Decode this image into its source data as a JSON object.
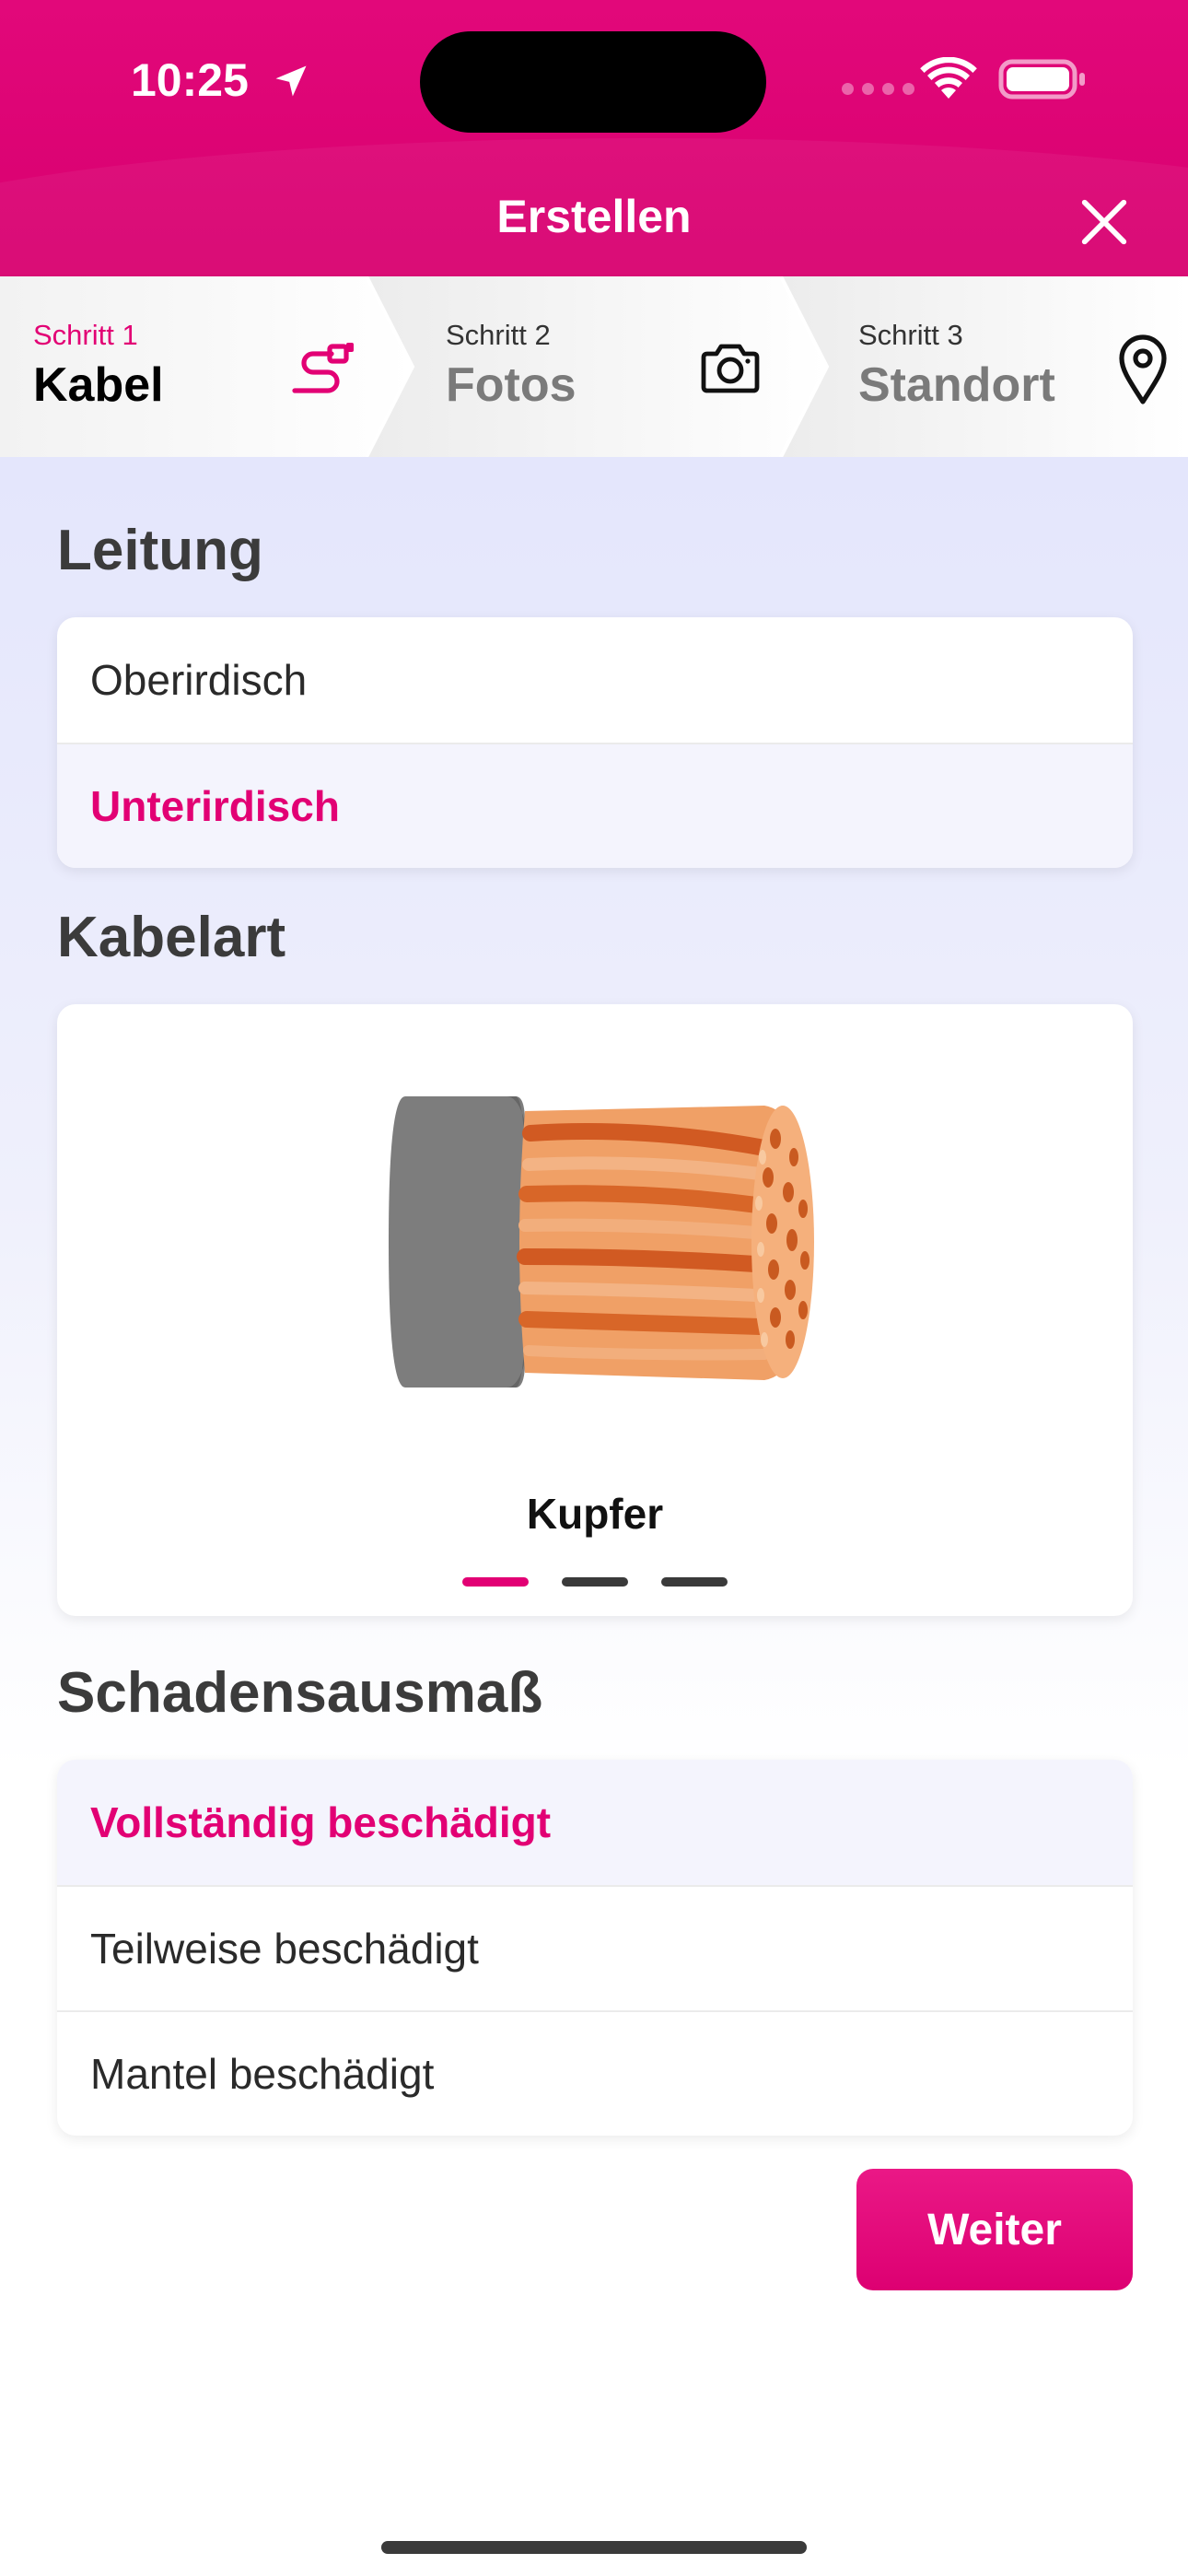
{
  "status_bar": {
    "time": "10:25",
    "icons": [
      "location-arrow-icon",
      "cellular-signal-icon",
      "wifi-icon",
      "battery-icon"
    ]
  },
  "header": {
    "title": "Erstellen",
    "close_icon": "close-icon",
    "color": "#e20074"
  },
  "stepper": {
    "steps": [
      {
        "label": "Schritt 1",
        "title": "Kabel",
        "icon": "cable-plug-icon",
        "active": true
      },
      {
        "label": "Schritt 2",
        "title": "Fotos",
        "icon": "camera-icon",
        "active": false
      },
      {
        "label": "Schritt 3",
        "title": "Standort",
        "icon": "location-pin-icon",
        "active": false
      }
    ]
  },
  "leitung": {
    "title": "Leitung",
    "options": [
      {
        "label": "Oberirdisch",
        "selected": false
      },
      {
        "label": "Unterirdisch",
        "selected": true
      }
    ]
  },
  "kabelart": {
    "title": "Kabelart",
    "selected_label": "Kupfer",
    "image": "copper-cable-illustration",
    "pager": {
      "count": 3,
      "active_index": 0
    }
  },
  "schadensausmass": {
    "title": "Schadensausmaß",
    "options": [
      {
        "label": "Vollständig beschädigt",
        "selected": true
      },
      {
        "label": "Teilweise beschädigt",
        "selected": false
      },
      {
        "label": "Mantel beschädigt",
        "selected": false
      }
    ]
  },
  "footer": {
    "next_label": "Weiter"
  },
  "colors": {
    "accent": "#e20074",
    "selected_bg": "#f4f4fd",
    "content_bg_top": "#e4e6fc"
  }
}
